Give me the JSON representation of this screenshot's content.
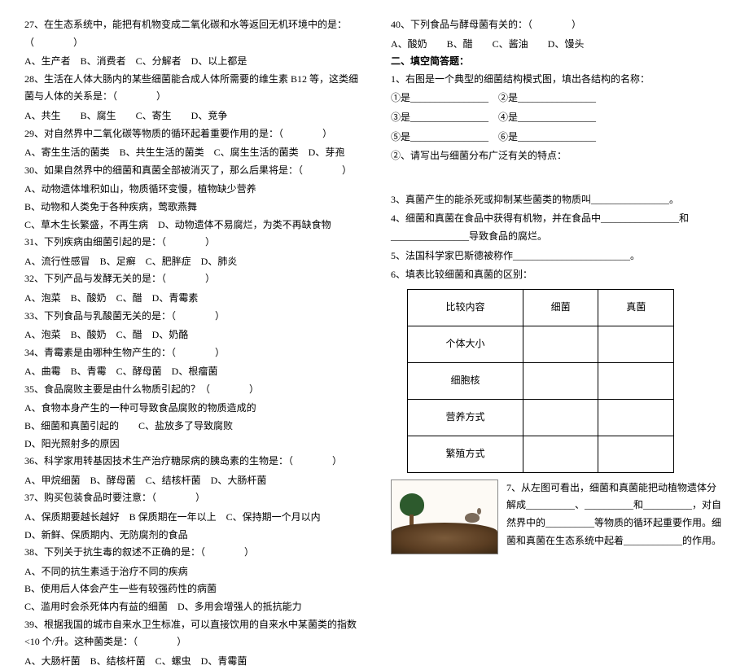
{
  "left": {
    "q27": "27、在生态系统中，能把有机物变成二氧化碳和水等返回无机环境中的是：（　　　　）",
    "q27o": "A、生产者　B、消费者　C、分解者　D、以上都是",
    "q28": "28、生活在人体大肠内的某些细菌能合成人体所需要的维生素 B12 等，这类细菌与人体的关系是：（　　　　）",
    "q28o": "A、共生　　B、腐生　　C、寄生　　D、竞争",
    "q29": "29、对自然界中二氧化碳等物质的循环起着重要作用的是：（　　　　）",
    "q29o": "A、寄生生活的菌类　B、共生生活的菌类　C、腐生生活的菌类　D、芽孢",
    "q30": "30、如果自然界中的细菌和真菌全部被消灭了，那么后果将是：（　　　　）",
    "q30a": "A、动物遗体堆积如山，物质循环变慢，植物缺少营养",
    "q30b": "B、动物和人类免于各种疾病，莺歌燕舞",
    "q30c": "C、草木生长繁盛，不再生病　D、动物遗体不易腐烂，为类不再缺食物",
    "q31": "31、下列疾病由细菌引起的是：（　　　　）",
    "q31o": "A、流行性感冒　B、足癣　C、肥胖症　D、肺炎",
    "q32": "32、下列产品与发酵无关的是：（　　　　）",
    "q32o": "A、泡菜　B、酸奶　C、醋　D、青霉素",
    "q33": "33、下列食品与乳酸菌无关的是：（　　　　）",
    "q33o": "A、泡菜　B、酸奶　C、醋　D、奶酪",
    "q34": "34、青霉素是由哪种生物产生的：（　　　　）",
    "q34o": "A、曲霉　B、青霉　C、酵母菌　D、根瘤菌",
    "q35": "35、食品腐败主要是由什么物质引起的？（　　　　）",
    "q35a": "A、食物本身产生的一种可导致食品腐败的物质造成的",
    "q35b": "B、细菌和真菌引起的　　C、盐放多了导致腐败",
    "q35c": "D、阳光照射多的原因",
    "q36": "36、科学家用转基因技术生产治疗糖尿病的胰岛素的生物是：（　　　　）",
    "q36o": "A、甲烷细菌　B、酵母菌　C、结核杆菌　D、大肠杆菌",
    "q37": "37、购买包装食品时要注意：（　　　　）",
    "q37o": "A、保质期要越长越好　B 保质期在一年以上　C、保持期一个月以内",
    "q37d": "D、新鲜、保质期内、无防腐剂的食品",
    "q38": "38、下列关于抗生毒的叙述不正确的是：（　　　　）",
    "q38a": "A、不同的抗生素适于治疗不同的疾病",
    "q38b": "B、使用后人体会产生一些有较强药性的病菌",
    "q38c": "C、滥用时会杀死体内有益的细菌　D、多用会增强人的抵抗能力",
    "q39": "39、根据我国的城市自来水卫生标准，可以直接饮用的自来水中某菌类的指数<10 个/升。这种菌类是：（　　　　）",
    "q39o": "A、大肠杆菌　B、结核杆菌　C、螺虫　D、青霉菌"
  },
  "right": {
    "q40": "40、下列食品与酵母菌有关的：（　　　　）",
    "q40o": "A、酸奶　　B、醋　　C、酱油　　D、馒头",
    "sec2": "二、填空简答题：",
    "p1": "1、右图是一个典型的细菌结构模式图，填出各结构的名称：",
    "p1a": "①是________________　②是________________",
    "p1b": "③是________________　④是________________",
    "p1c": "⑤是________________　⑥是________________",
    "p2": "②、请写出与细菌分布广泛有关的特点：",
    "p3": "3、真菌产生的能杀死或抑制某些菌类的物质叫________________。",
    "p4": "4、细菌和真菌在食品中获得有机物，并在食品中________________和________________导致食品的腐烂。",
    "p5": "5、法国科学家巴斯德被称作________________________。",
    "p6": "6、填表比较细菌和真菌的区别：",
    "th1": "比较内容",
    "th2": "细菌",
    "th3": "真菌",
    "r1": "个体大小",
    "r2": "细胞核",
    "r3": "营养方式",
    "r4": "繁殖方式",
    "q7a": "7、从左图可看出，细菌和真菌能把动植物遗体分解成__________、__________和__________，对自然界中的__________等物质的循环起重要作用。细菌和真菌在生态系统中起着____________的作用。"
  }
}
